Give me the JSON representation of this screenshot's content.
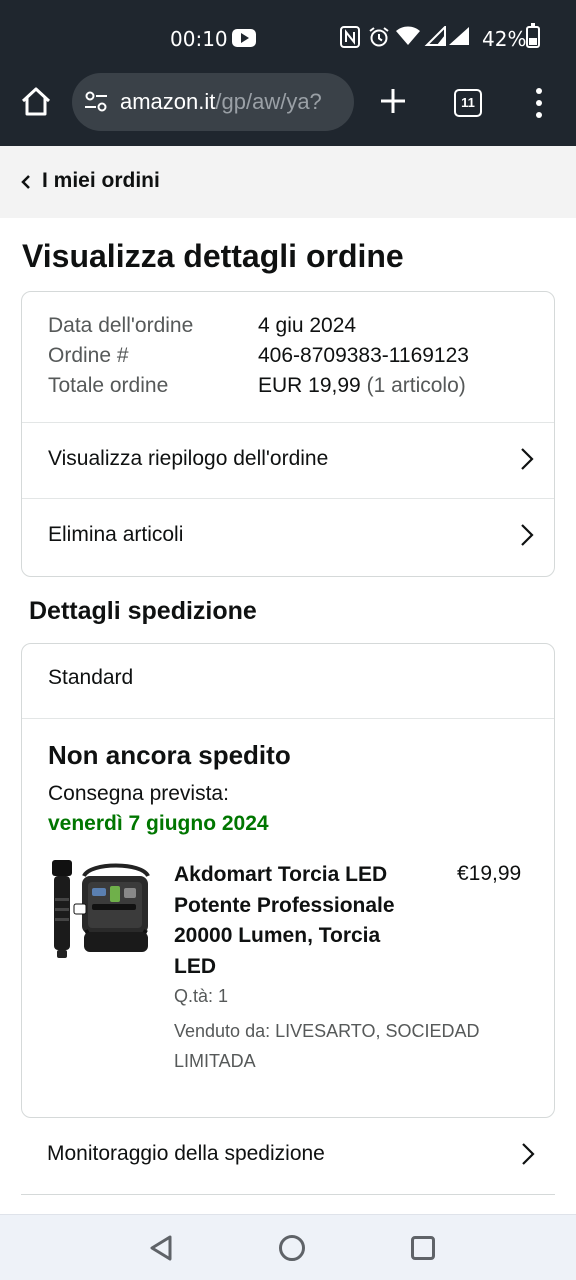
{
  "status_bar": {
    "time": "00:10",
    "battery_pct": "42%",
    "battery_level": 0.42
  },
  "browser": {
    "url_domain": "amazon.it",
    "url_path": "/gp/aw/ya?",
    "tab_count": "11"
  },
  "nav": {
    "back_label": "I miei ordini"
  },
  "page": {
    "title": "Visualizza dettagli ordine"
  },
  "order": {
    "date_label": "Data dell'ordine",
    "date_value": "4 giu 2024",
    "number_label": "Ordine #",
    "number_value": "406-8709383-1169123",
    "total_label": "Totale ordine",
    "total_value": "EUR 19,99",
    "total_items": "(1 articolo)",
    "links": [
      {
        "label": "Visualizza riepilogo dell'ordine"
      },
      {
        "label": "Elimina articoli"
      }
    ]
  },
  "shipping": {
    "section_title": "Dettagli spedizione",
    "type": "Standard",
    "status": "Non ancora spedito",
    "delivery_label": "Consegna prevista:",
    "delivery_date": "venerdì 7 giugno 2024",
    "product": {
      "title": "Akdomart Torcia LED Potente Professionale 20000 Lumen, Torcia LED",
      "price": "€19,99",
      "qty": "Q.tà: 1",
      "seller": "Venduto da: LIVESARTO, SOCIEDAD LIMITADA"
    },
    "tracking_label": "Monitoraggio della spedizione"
  },
  "colors": {
    "chrome": "#1f262e",
    "delivery_green": "#007600",
    "border": "#d5d9d9"
  },
  "icons": [
    "home-icon",
    "site-settings-icon",
    "plus-icon",
    "tabs-icon",
    "more-vert-icon",
    "chevron-left-icon",
    "chevron-right-icon",
    "nav-back-icon",
    "nav-home-icon",
    "nav-recents-icon"
  ]
}
